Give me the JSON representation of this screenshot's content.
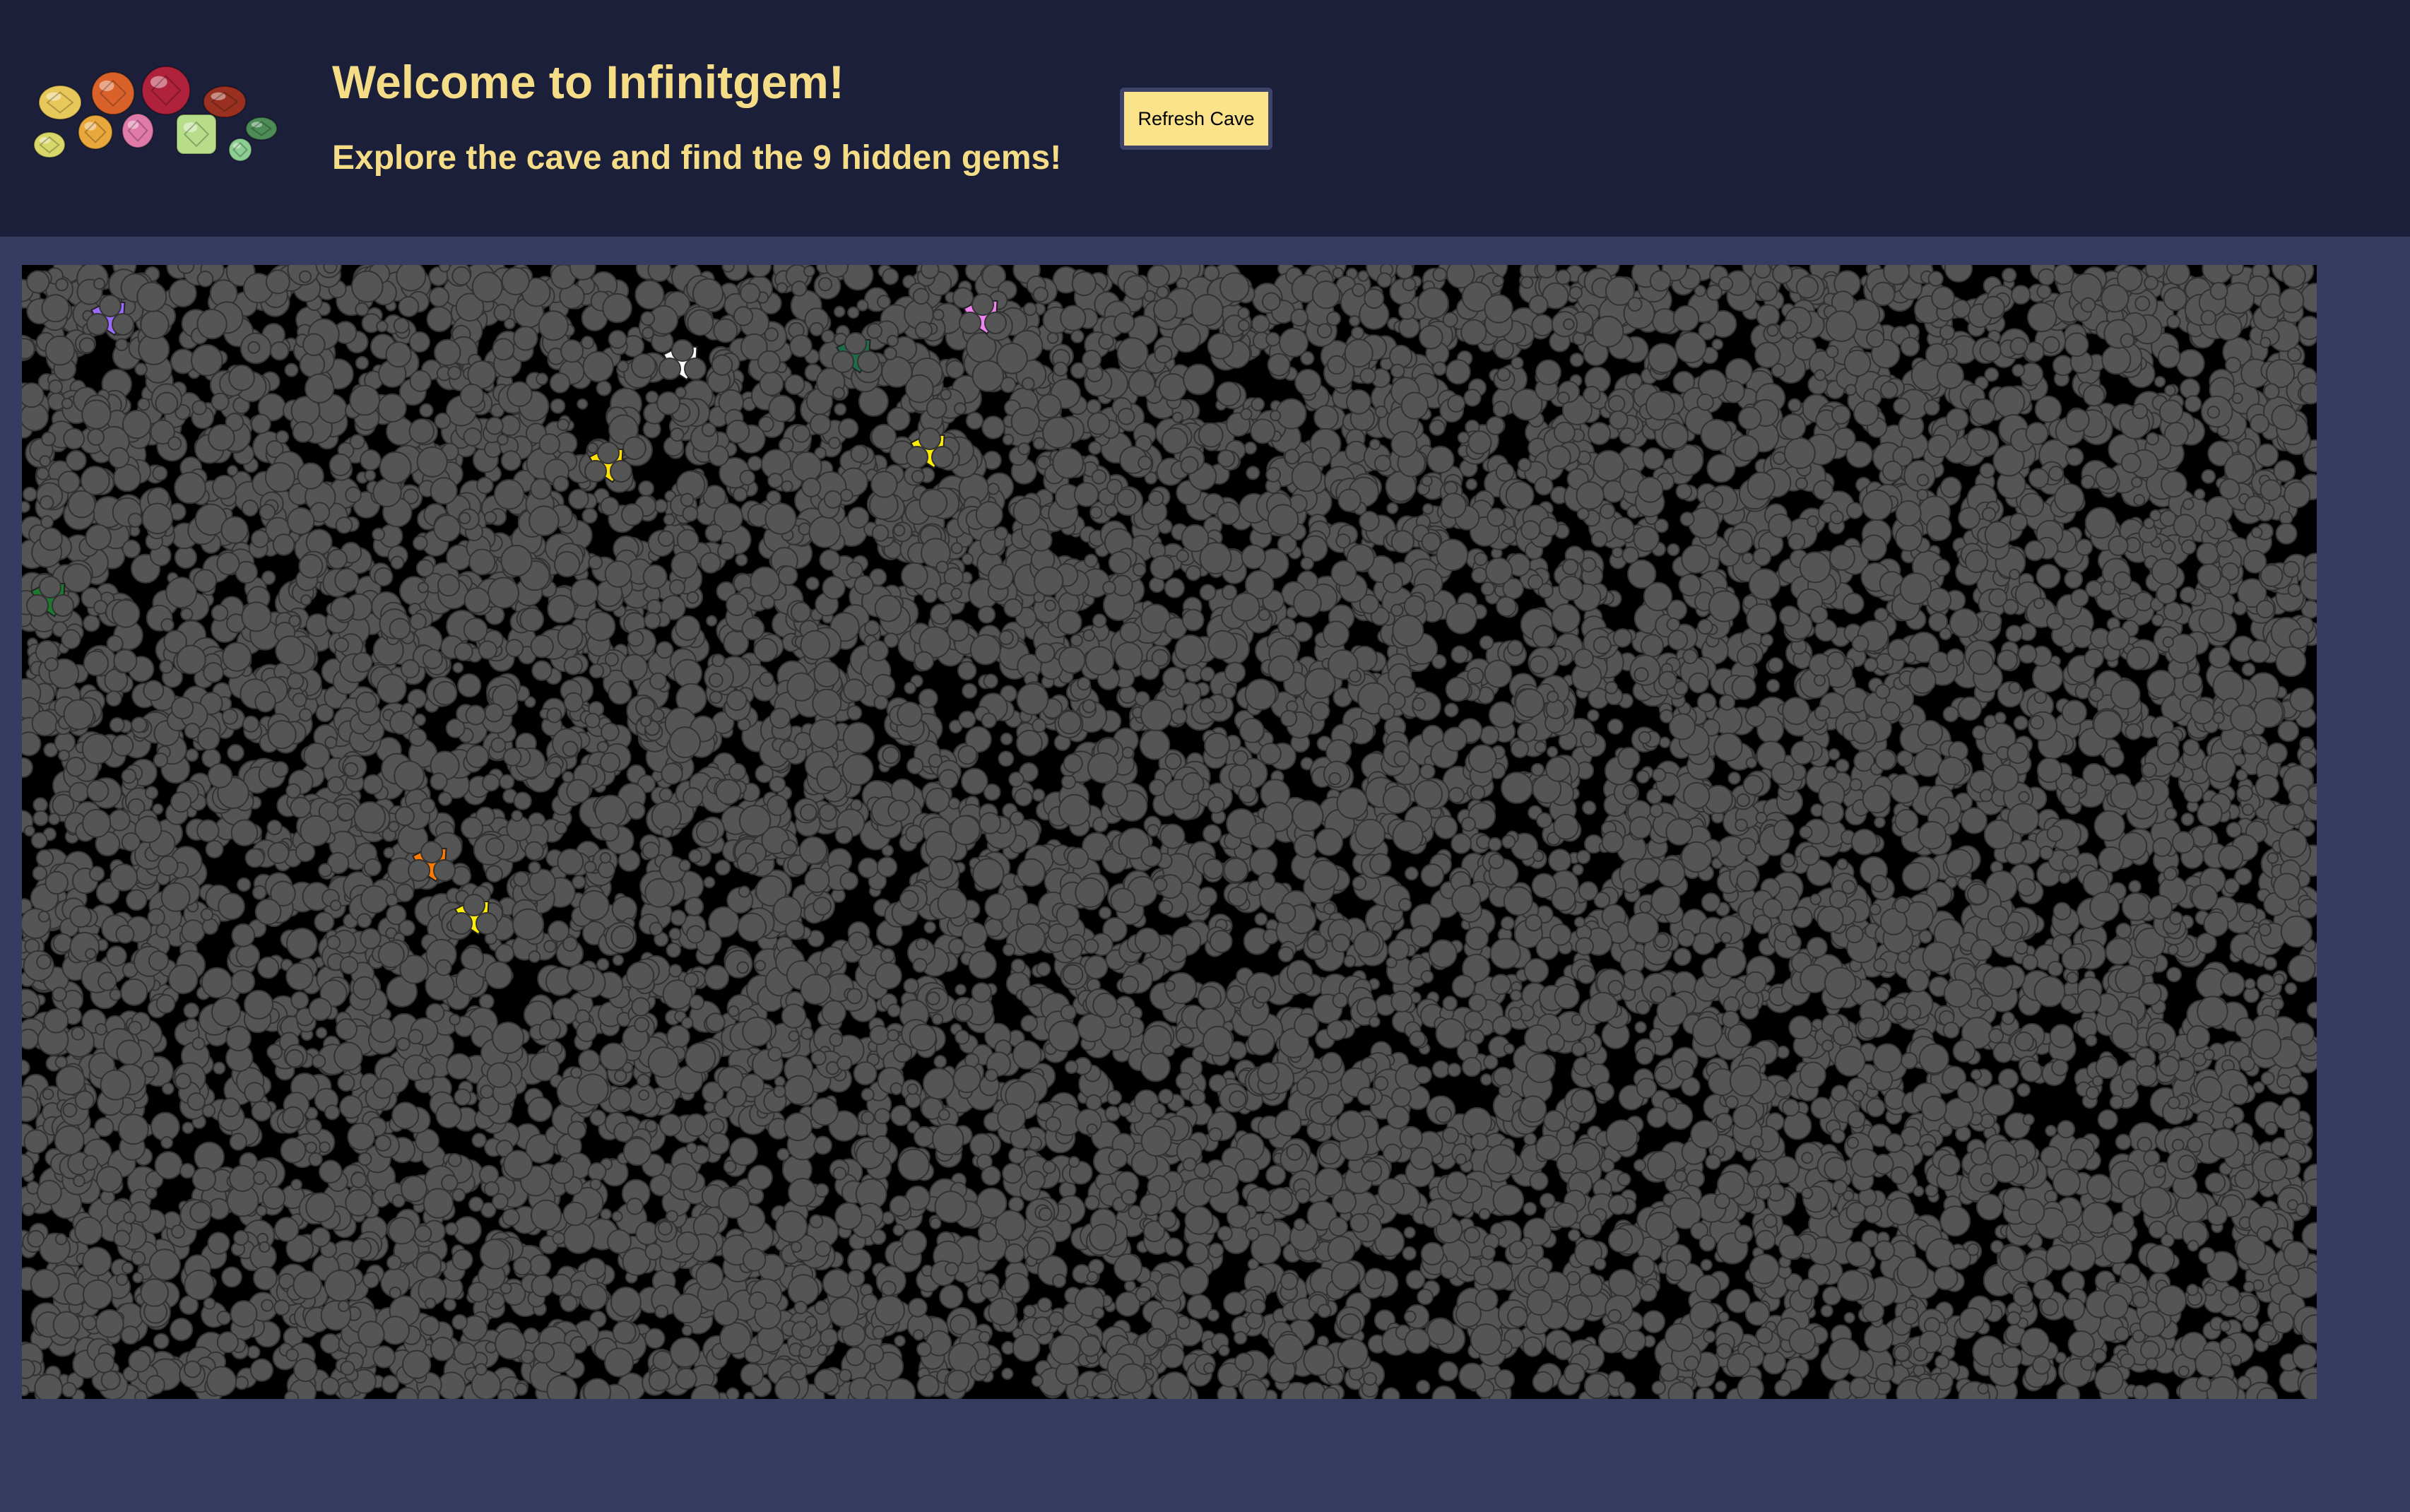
{
  "header": {
    "title": "Welcome to Infinitgem!",
    "subtitle": "Explore the cave and find the 9 hidden gems!",
    "refresh_label": "Refresh Cave",
    "logo_gems": [
      {
        "color": "#e8c85a",
        "shape": "oval"
      },
      {
        "color": "#d9622b",
        "shape": "round"
      },
      {
        "color": "#b0213c",
        "shape": "round"
      },
      {
        "color": "#9a3120",
        "shape": "oval"
      },
      {
        "color": "#d8d86a",
        "shape": "oval"
      },
      {
        "color": "#e9a83c",
        "shape": "round"
      },
      {
        "color": "#e07aa8",
        "shape": "pear"
      },
      {
        "color": "#b7dc8a",
        "shape": "cushion"
      },
      {
        "color": "#8ccf92",
        "shape": "round"
      },
      {
        "color": "#4e8c57",
        "shape": "oval"
      }
    ]
  },
  "cave": {
    "rock_color": "#555555",
    "rock_outline": "#333333",
    "background": "#000000",
    "gem_count": 9,
    "gems": [
      {
        "name": "amethyst",
        "color": "#9a6bff"
      },
      {
        "name": "diamond",
        "color": "#ffffff"
      },
      {
        "name": "emerald",
        "color": "#1e6b47"
      },
      {
        "name": "pink-sapphire",
        "color": "#ee82ee"
      },
      {
        "name": "citrine",
        "color": "#ffee00"
      },
      {
        "name": "topaz",
        "color": "#ffe000"
      },
      {
        "name": "jade",
        "color": "#1b7a2e"
      },
      {
        "name": "fire-opal",
        "color": "#ff7a00"
      },
      {
        "name": "yellow-sapphire",
        "color": "#ffee00"
      }
    ]
  }
}
